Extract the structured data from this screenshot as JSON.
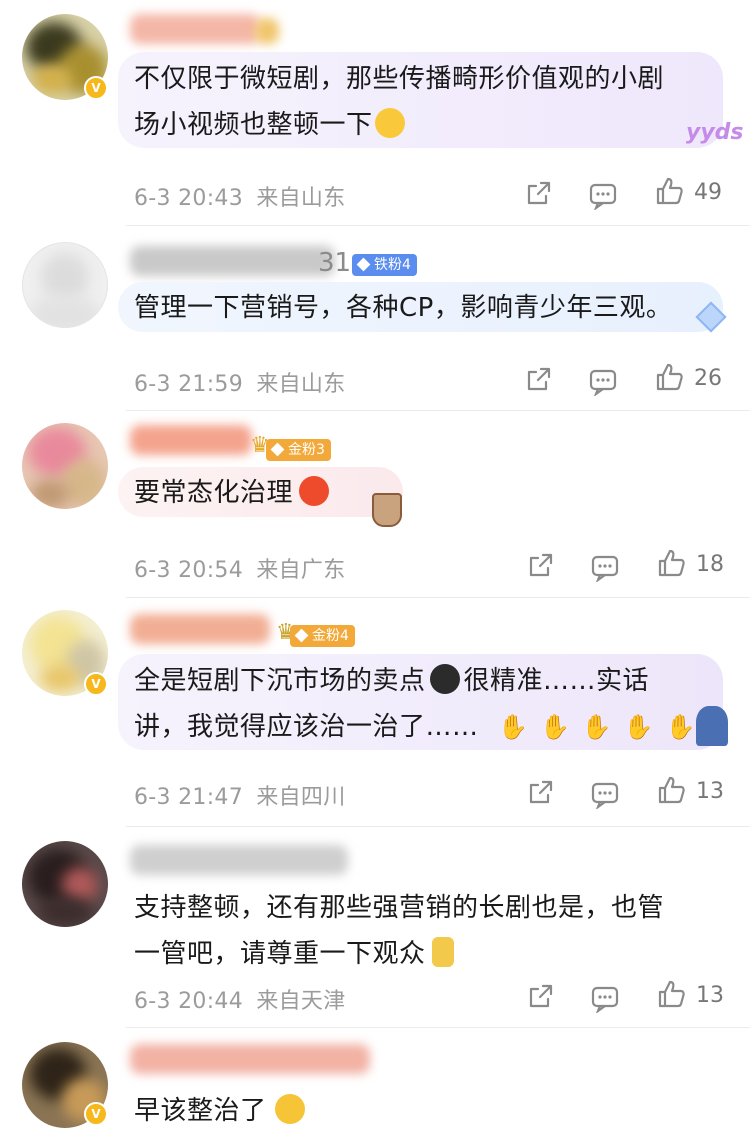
{
  "comments": [
    {
      "text_lines": [
        "不仅限于微短剧，那些传播畸形价值观的小剧",
        "场小视频也整顿一下"
      ],
      "date": "6-3 20:43",
      "location": "来自山东",
      "likes": "49",
      "sticker": "yyds"
    },
    {
      "name_tail": "31",
      "badge": "铁粉4",
      "text_lines": [
        "管理一下营销号，各种CP，影响青少年三观。"
      ],
      "date": "6-3 21:59",
      "location": "来自山东",
      "likes": "26"
    },
    {
      "badge": "金粉3",
      "text_lines": [
        "要常态化治理"
      ],
      "date": "6-3 20:54",
      "location": "来自广东",
      "likes": "18"
    },
    {
      "badge": "金粉4",
      "text_lines": [
        "全是短剧下沉市场的卖点",
        "很精准……实话",
        "讲，我觉得应该治一治了……"
      ],
      "date": "6-3 21:47",
      "location": "来自四川",
      "likes": "13"
    },
    {
      "text_lines": [
        "支持整顿，还有那些强营销的长剧也是，也管",
        "一管吧，请尊重一下观众"
      ],
      "date": "6-3 20:44",
      "location": "来自天津",
      "likes": "13"
    },
    {
      "text_lines": [
        "早该整治了"
      ]
    }
  ],
  "icons": {
    "share": "share-icon",
    "comment": "comment-icon",
    "like": "thumbs-up-icon"
  },
  "colors": {
    "iron_badge": "#5b8def",
    "gold_badge": "#f2a93a",
    "meta_text": "#9b9b9b"
  }
}
